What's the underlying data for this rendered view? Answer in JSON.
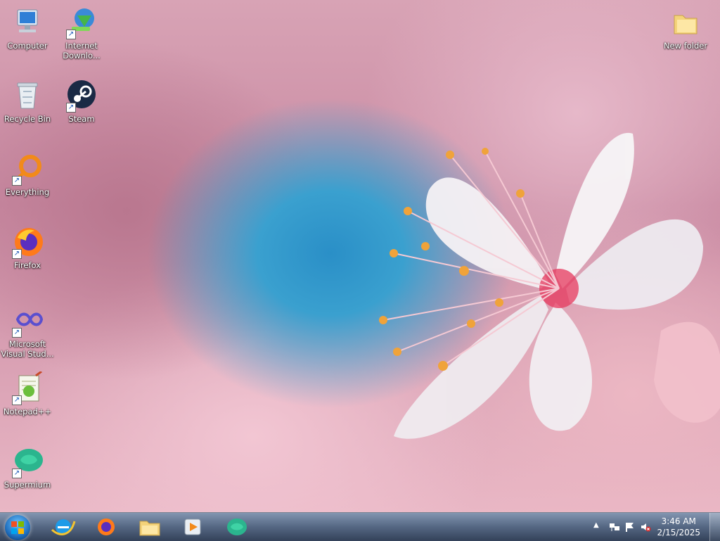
{
  "desktop": {
    "icons": [
      {
        "label": "Computer",
        "icon": "computer-icon"
      },
      {
        "label": "Internet Downlo...",
        "icon": "internet-download-manager-icon"
      },
      {
        "label": "Recycle Bin",
        "icon": "recycle-bin-icon"
      },
      {
        "label": "Steam",
        "icon": "steam-icon"
      },
      {
        "label": "Everything",
        "icon": "everything-search-icon"
      },
      {
        "label": "Firefox",
        "icon": "firefox-icon"
      },
      {
        "label": "Microsoft Visual Stud...",
        "icon": "visual-studio-icon"
      },
      {
        "label": "Notepad++",
        "icon": "notepad-plus-plus-icon"
      },
      {
        "label": "Supermium",
        "icon": "supermium-icon"
      },
      {
        "label": "New folder",
        "icon": "folder-icon"
      }
    ]
  },
  "taskbar": {
    "pinned": [
      "internet-explorer-icon",
      "firefox-icon",
      "file-explorer-icon",
      "media-player-icon",
      "supermium-icon"
    ],
    "tray": {
      "time": "3:46 AM",
      "date": "2/15/2025",
      "icons": [
        "show-hidden-icons-chevron",
        "network-icon",
        "action-center-flag-icon",
        "volume-muted-icon"
      ]
    }
  },
  "colors": {
    "taskbar": "#3a4b66",
    "accent": "#1f6fbf",
    "wallpaper_blue": "#2a8fc7",
    "wallpaper_pink": "#e9b7c5"
  }
}
